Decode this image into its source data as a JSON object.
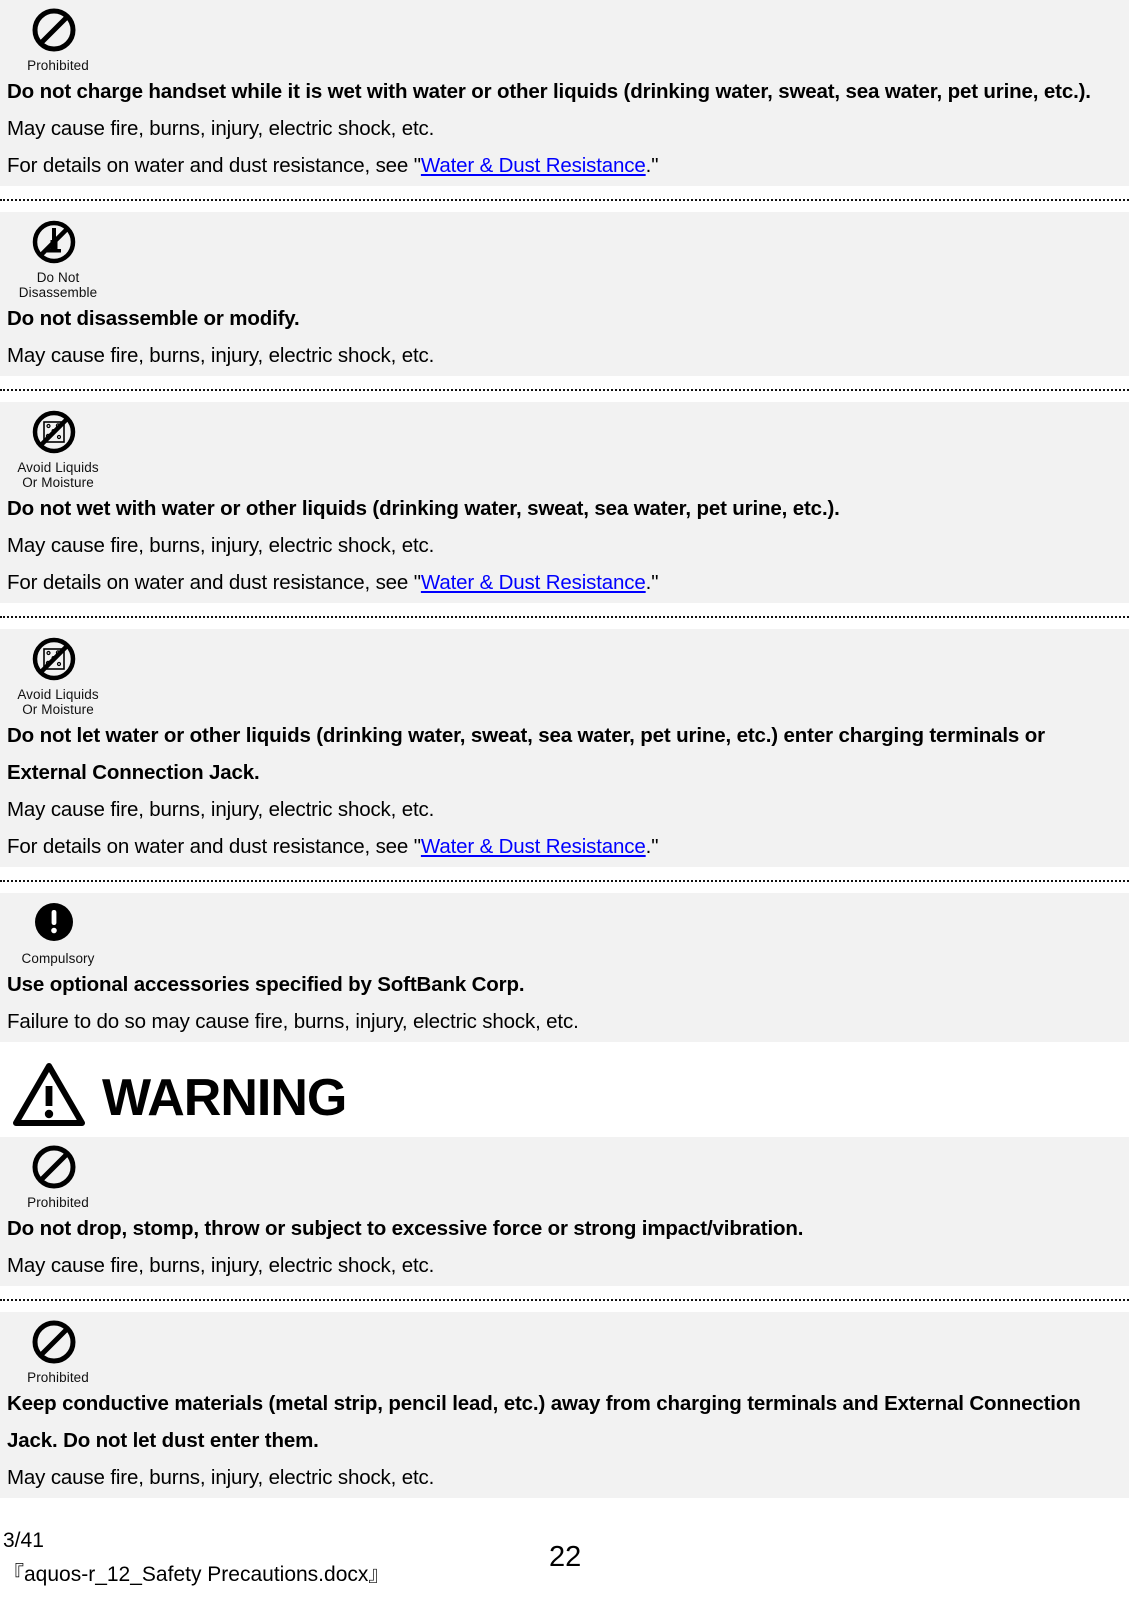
{
  "document": {
    "background_color": "#f2f2f2",
    "link_color": "#0000ff",
    "text_color": "#000000"
  },
  "icons": {
    "prohibited": {
      "name": "prohibited-icon",
      "caption": "Prohibited"
    },
    "do_not_disassemble": {
      "name": "do-not-disassemble-icon",
      "caption_line1": "Do Not",
      "caption_line2": "Disassemble"
    },
    "avoid_liquids": {
      "name": "avoid-liquids-icon",
      "caption_line1": "Avoid Liquids",
      "caption_line2": "Or Moisture"
    },
    "compulsory": {
      "name": "compulsory-icon",
      "caption": "Compulsory"
    },
    "warning_triangle": {
      "name": "warning-triangle-icon"
    }
  },
  "link_label": "Water & Dust Resistance",
  "sections": [
    {
      "icon": "prohibited",
      "heading": "Do not charge handset while it is wet with water or other liquids (drinking water, sweat, sea water, pet urine, etc.).",
      "lines": [
        "May cause fire, burns, injury, electric shock, etc."
      ],
      "link_line_prefix": "For details on water and dust resistance, see \"",
      "link_line_suffix": ".\""
    },
    {
      "icon": "do_not_disassemble",
      "heading": "Do not disassemble or modify.",
      "lines": [
        "May cause fire, burns, injury, electric shock, etc."
      ]
    },
    {
      "icon": "avoid_liquids",
      "heading": "Do not wet with water or other liquids (drinking water, sweat, sea water, pet urine, etc.).",
      "lines": [
        "May cause fire, burns, injury, electric shock, etc."
      ],
      "link_line_prefix": "For details on water and dust resistance, see \"",
      "link_line_suffix": ".\""
    },
    {
      "icon": "avoid_liquids",
      "heading": "Do not let water or other liquids (drinking water, sweat, sea water, pet urine, etc.) enter charging terminals or External Connection Jack.",
      "lines": [
        "May cause fire, burns, injury, electric shock, etc."
      ],
      "link_line_prefix": "For details on water and dust resistance, see \"",
      "link_line_suffix": ".\""
    },
    {
      "icon": "compulsory",
      "heading": "Use optional accessories specified by SoftBank Corp.",
      "lines": [
        "Failure to do so may cause fire, burns, injury, electric shock, etc."
      ]
    }
  ],
  "warning_banner": {
    "label": "WARNING"
  },
  "sections_after_warning": [
    {
      "icon": "prohibited",
      "heading": "Do not drop, stomp, throw or subject to excessive force or strong impact/vibration.",
      "lines": [
        "May cause fire, burns, injury, electric shock, etc."
      ]
    },
    {
      "icon": "prohibited",
      "heading": "Keep conductive materials (metal strip, pencil lead, etc.) away from charging terminals and External Connection Jack. Do not let dust enter them.",
      "lines": [
        "May cause fire, burns, injury, electric shock, etc."
      ]
    }
  ],
  "footer": {
    "revision": "3/41",
    "filename": "『aquos-r_12_Safety Precautions.docx』",
    "page_number": "22"
  }
}
